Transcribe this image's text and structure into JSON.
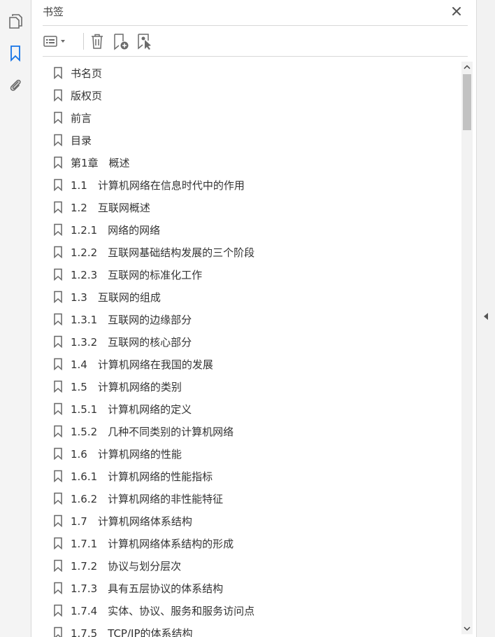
{
  "panel": {
    "title": "书签"
  },
  "left_rail": {
    "icons": [
      {
        "name": "pages-icon",
        "active": false
      },
      {
        "name": "bookmark-icon",
        "active": true
      },
      {
        "name": "attachment-icon",
        "active": false
      }
    ]
  },
  "toolbar": {
    "icons": [
      "options-menu-icon",
      "delete-icon",
      "new-bookmark-icon",
      "bookmark-select-icon"
    ]
  },
  "bookmarks": [
    {
      "label": "书名页"
    },
    {
      "label": "版权页"
    },
    {
      "label": "前言"
    },
    {
      "label": "目录"
    },
    {
      "label": "第1章　概述"
    },
    {
      "label": "1.1　计算机网络在信息时代中的作用"
    },
    {
      "label": "1.2　互联网概述"
    },
    {
      "label": "1.2.1　网络的网络"
    },
    {
      "label": "1.2.2　互联网基础结构发展的三个阶段"
    },
    {
      "label": "1.2.3　互联网的标准化工作"
    },
    {
      "label": "1.3　互联网的组成"
    },
    {
      "label": "1.3.1　互联网的边缘部分"
    },
    {
      "label": "1.3.2　互联网的核心部分"
    },
    {
      "label": "1.4　计算机网络在我国的发展"
    },
    {
      "label": "1.5　计算机网络的类别"
    },
    {
      "label": "1.5.1　计算机网络的定义"
    },
    {
      "label": "1.5.2　几种不同类别的计算机网络"
    },
    {
      "label": "1.6　计算机网络的性能"
    },
    {
      "label": "1.6.1　计算机网络的性能指标"
    },
    {
      "label": "1.6.2　计算机网络的非性能特征"
    },
    {
      "label": "1.7　计算机网络体系结构"
    },
    {
      "label": "1.7.1　计算机网络体系结构的形成"
    },
    {
      "label": "1.7.2　协议与划分层次"
    },
    {
      "label": "1.7.3　具有五层协议的体系结构"
    },
    {
      "label": "1.7.4　实体、协议、服务和服务访问点"
    },
    {
      "label": "1.7.5　TCP/IP的体系结构"
    }
  ],
  "colors": {
    "accent": "#1473e6",
    "icon": "#6b6b6b"
  }
}
